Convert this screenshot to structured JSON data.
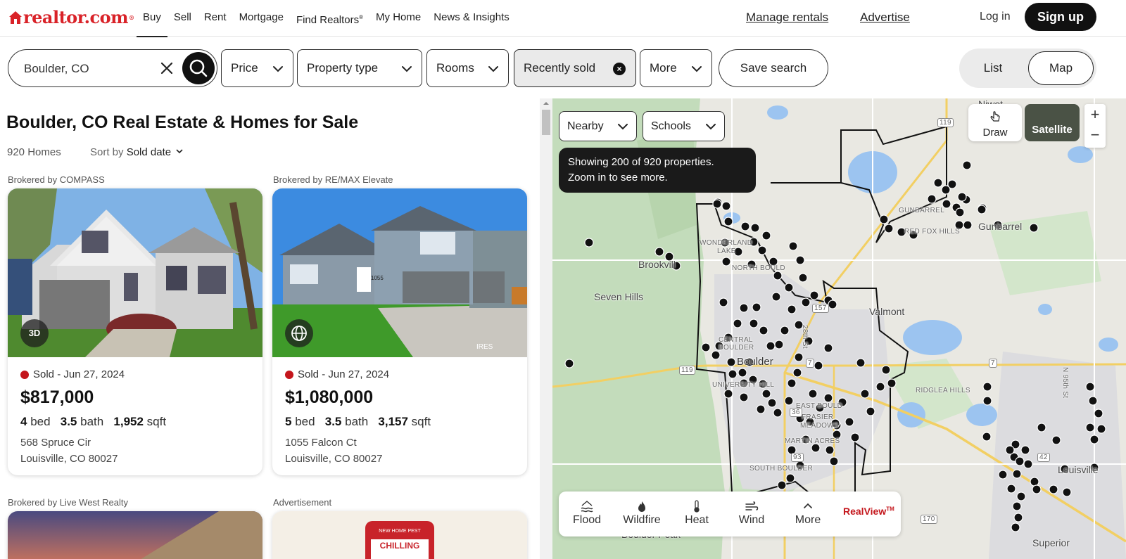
{
  "brand": {
    "name": "realtor.com",
    "mark": "®",
    "color": "#d92228"
  },
  "nav": {
    "links": [
      "Buy",
      "Sell",
      "Rent",
      "Mortgage",
      "Find Realtors",
      "My Home",
      "News & Insights"
    ],
    "active": "Buy",
    "find_realtors_mark": "®",
    "manage_rentals": "Manage rentals",
    "advertise": "Advertise",
    "login": "Log in",
    "signup": "Sign up"
  },
  "filters": {
    "search_value": "Boulder, CO",
    "price": "Price",
    "property_type": "Property type",
    "rooms": "Rooms",
    "recently_sold": "Recently sold",
    "more": "More",
    "save_search": "Save search",
    "view_list": "List",
    "view_map": "Map",
    "active_view": "Map"
  },
  "listing": {
    "title": "Boulder, CO Real Estate & Homes for Sale",
    "count": "920 Homes",
    "sort_label": "Sort by",
    "sort_value": "Sold date",
    "cards": [
      {
        "broker": "Brokered by COMPASS",
        "badge": "3D",
        "badge_icon": "3d-tour-icon",
        "status": "Sold - Jun 27, 2024",
        "price": "$817,000",
        "beds": "4",
        "beds_label": "bed",
        "baths": "3.5",
        "baths_label": "bath",
        "sqft": "1,952",
        "sqft_label": "sqft",
        "address1": "568 Spruce Cir",
        "address2": "Louisville, CO 80027"
      },
      {
        "broker": "Brokered by RE/MAX Elevate",
        "badge_icon": "globe-icon",
        "status": "Sold - Jun 27, 2024",
        "price": "$1,080,000",
        "beds": "5",
        "beds_label": "bed",
        "baths": "3.5",
        "baths_label": "bath",
        "sqft": "3,157",
        "sqft_label": "sqft",
        "address1": "1055 Falcon Ct",
        "address2": "Louisville, CO 80027",
        "house_number": "1055",
        "watermark": "IRES"
      }
    ],
    "next_brokers": [
      "Brokered by Live West Realty",
      "Advertisement"
    ],
    "ad_badge": "NEW HOME PEST",
    "ad_text": "CHILLING"
  },
  "map": {
    "nearby": "Nearby",
    "schools": "Schools",
    "tooltip_line1": "Showing 200 of 920 properties.",
    "tooltip_line2": "Zoom in to see more.",
    "draw": "Draw",
    "satellite": "Satellite",
    "zoom_in": "+",
    "zoom_out": "−",
    "layers": [
      {
        "label": "Flood",
        "icon": "flood-icon"
      },
      {
        "label": "Wildfire",
        "icon": "wildfire-icon"
      },
      {
        "label": "Heat",
        "icon": "heat-icon"
      },
      {
        "label": "Wind",
        "icon": "wind-icon"
      },
      {
        "label": "More",
        "icon": "chevron-up-icon"
      }
    ],
    "realview": "RealView",
    "realview_tm": "TM",
    "places": {
      "niwot": "Niwot",
      "gunbarrel": "Gunbarrel",
      "gunbarrel_caps": "GUNBARREL",
      "red_fox_hills": "RED FOX HILLS",
      "wonderland_lake": "WONDERLAND",
      "lake": "LAKE",
      "north_boulder": "NORTH BOULD",
      "brookville": "Brookvill",
      "seven_hills": "Seven Hills",
      "valmont": "Valmont",
      "central_boulder": "CENTRAL",
      "central_boulder2": "BOULDER",
      "boulder": "Boulder",
      "university_hill": "UNIVERSITY HILL",
      "east_boulder": "EAST BOULD",
      "frasier_meadows": "FRASIER",
      "frasier_meadows2": "MEADOWS",
      "martin_acres": "MARTIN ACRES",
      "south_boulder": "SOUTH BOULDER",
      "ridglea_hills": "RIDGLEA HILLS",
      "louisville": "Louisville",
      "superior": "Superior",
      "boulder_peak": "Boulder Peak",
      "n95th": "N 95th St",
      "n28th": "28th St"
    },
    "route_shields": [
      "119",
      "119",
      "7",
      "7",
      "157",
      "36",
      "93",
      "42",
      "170"
    ],
    "colors": {
      "land": "#e9e8e2",
      "forest": "#c7dfc0",
      "water": "#9cc4f0",
      "road": "#f2cf63",
      "boundary": "#111111",
      "marker": "#111111"
    }
  }
}
